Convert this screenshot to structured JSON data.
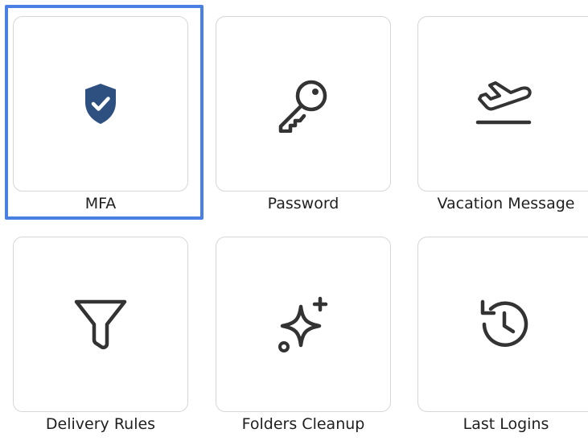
{
  "tiles": [
    {
      "label": "MFA",
      "icon": "shield-check-icon",
      "selected": true
    },
    {
      "label": "Password",
      "icon": "key-icon",
      "selected": false
    },
    {
      "label": "Vacation Message",
      "icon": "airplane-takeoff-icon",
      "selected": false
    },
    {
      "label": "Delivery Rules",
      "icon": "filter-icon",
      "selected": false
    },
    {
      "label": "Folders Cleanup",
      "icon": "sparkle-icon",
      "selected": false
    },
    {
      "label": "Last Logins",
      "icon": "history-icon",
      "selected": false
    }
  ],
  "colors": {
    "selection_border": "#4a80e4",
    "card_border": "#d6d6d6",
    "mfa_icon_fill": "#2e5080",
    "icon_stroke": "#333333",
    "label_text": "#1f1f1f"
  }
}
